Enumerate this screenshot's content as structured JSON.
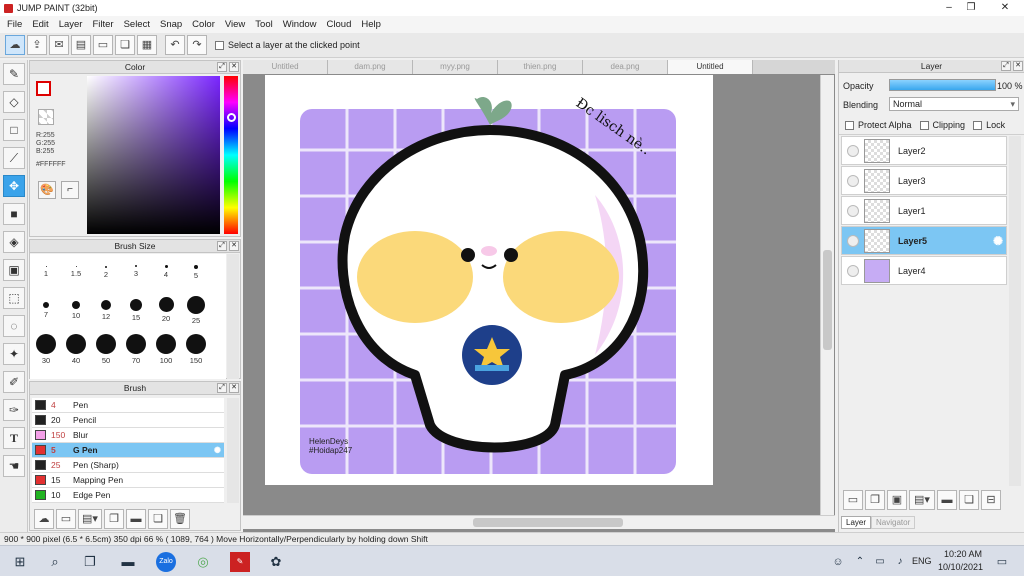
{
  "window": {
    "title": "JUMP PAINT (32bit)",
    "minimize": "–",
    "maximize": "❐",
    "close": "✕"
  },
  "menu": [
    "File",
    "Edit",
    "Layer",
    "Filter",
    "Select",
    "Snap",
    "Color",
    "View",
    "Tool",
    "Window",
    "Cloud",
    "Help"
  ],
  "toolbar": {
    "select_layer_label": "Select a layer at the clicked point"
  },
  "color_panel": {
    "title": "Color",
    "r": "R:255",
    "g": "G:255",
    "b": "B:255",
    "hex": "#FFFFFF"
  },
  "brush_size_panel": {
    "title": "Brush Size",
    "sizes": [
      "1",
      "1.5",
      "2",
      "3",
      "4",
      "5",
      "7",
      "10",
      "12",
      "15",
      "20",
      "25",
      "30",
      "40",
      "50",
      "70",
      "100",
      "150"
    ]
  },
  "brush_panel": {
    "title": "Brush",
    "items": [
      {
        "size": "4",
        "name": "Pen",
        "color": "#222222"
      },
      {
        "size": "20",
        "name": "Pencil",
        "color": "#222222"
      },
      {
        "size": "150",
        "name": "Blur",
        "color": "#f4a0e8"
      },
      {
        "size": "5",
        "name": "G Pen",
        "color": "#e23030"
      },
      {
        "size": "25",
        "name": "Pen (Sharp)",
        "color": "#222222"
      },
      {
        "size": "15",
        "name": "Mapping Pen",
        "color": "#e23030"
      },
      {
        "size": "10",
        "name": "Edge Pen",
        "color": "#22b322"
      }
    ]
  },
  "tabs": [
    "Untitled",
    "dam.png",
    "myy.png",
    "thien.png",
    "dea.png",
    "Untitled"
  ],
  "canvas": {
    "handwriting": "Đc lisch nè..",
    "watermark_line1": "HelenDeys",
    "watermark_line2": "#Hoidap247"
  },
  "layer_panel": {
    "title": "Layer",
    "opacity_label": "Opacity",
    "opacity_value": "100 %",
    "opacity": 1.0,
    "blending_label": "Blending",
    "blending_value": "Normal",
    "protect_alpha": "Protect Alpha",
    "clipping": "Clipping",
    "lock": "Lock",
    "layers": [
      "Layer2",
      "Layer3",
      "Layer1",
      "Layer5",
      "Layer4"
    ],
    "tab_layer": "Layer",
    "tab_navigator": "Navigator"
  },
  "status": {
    "text": "900 * 900 pixel   (6.5 * 6.5cm)   350 dpi   66 %   ( 1089, 764 )   Move Horizontally/Perpendicularly by holding down Shift"
  },
  "taskbar": {
    "lang": "ENG",
    "time": "10:20 AM",
    "date": "10/10/2021"
  },
  "colors": {
    "accent": "#3aa3ea",
    "selected_row": "#7cc6f3",
    "canvas_purple": "#b99cf2",
    "cheeks": "#fbd97a"
  }
}
